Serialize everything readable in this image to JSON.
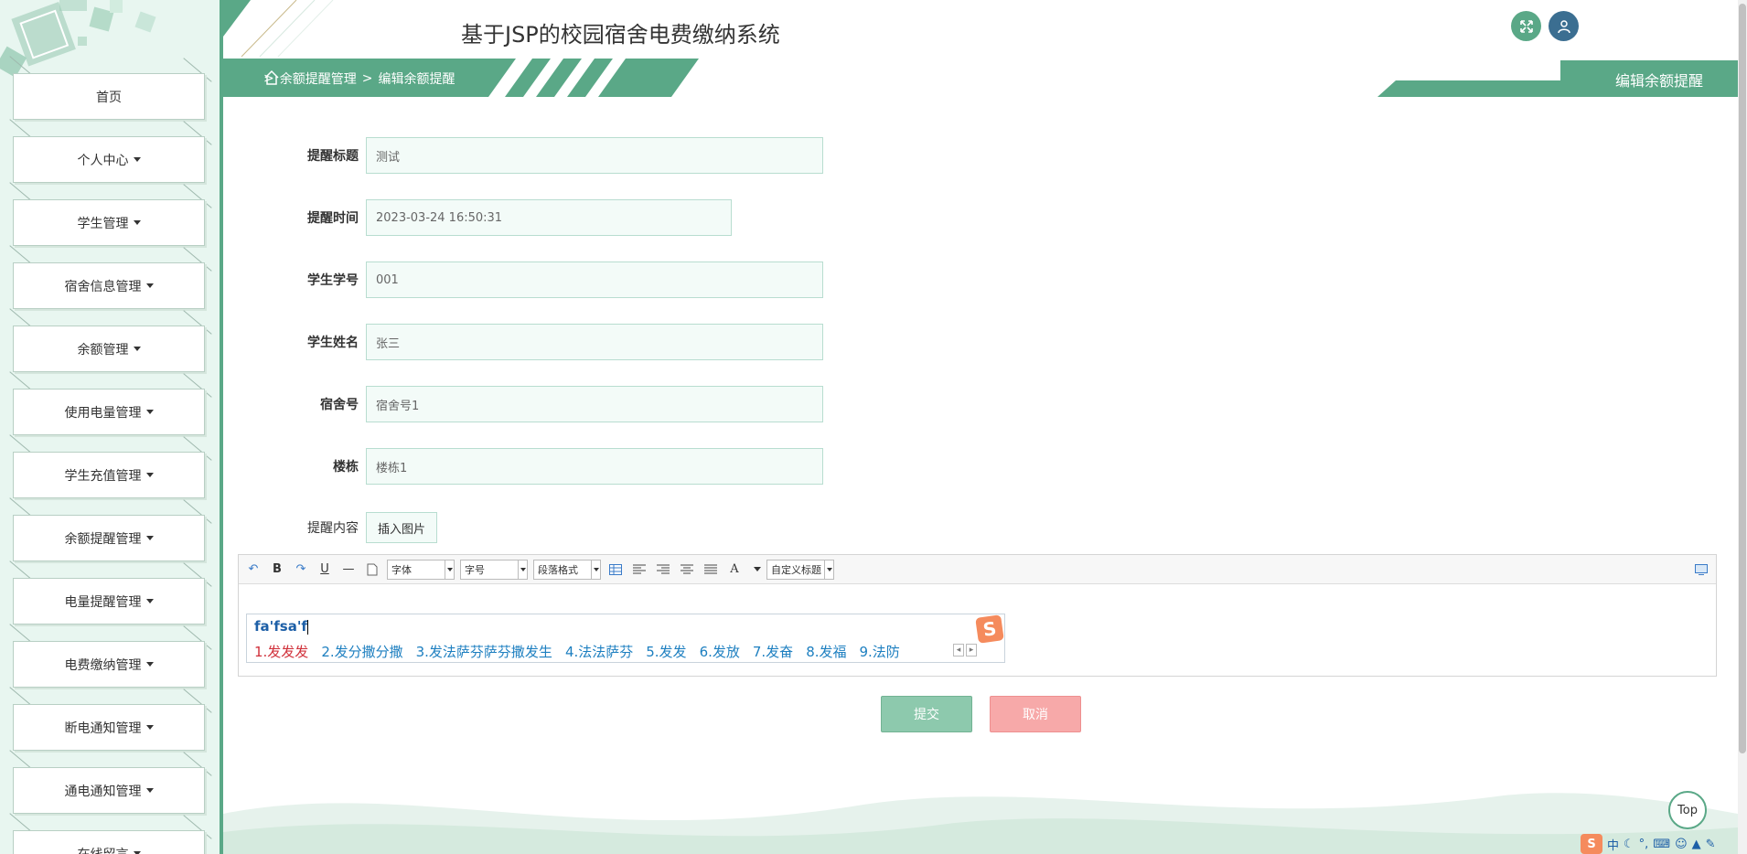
{
  "header": {
    "title": "基于JSP的校园宿舍电费缴纳系统"
  },
  "breadcrumb": {
    "sep1": ">",
    "item1": "余额提醒管理",
    "sep2": ">",
    "item2": "编辑余额提醒"
  },
  "page_tag": "编辑余额提醒",
  "sidebar": {
    "items": [
      {
        "label": "首页",
        "dropdown": false
      },
      {
        "label": "个人中心",
        "dropdown": true
      },
      {
        "label": "学生管理",
        "dropdown": true
      },
      {
        "label": "宿舍信息管理",
        "dropdown": true
      },
      {
        "label": "余额管理",
        "dropdown": true
      },
      {
        "label": "使用电量管理",
        "dropdown": true
      },
      {
        "label": "学生充值管理",
        "dropdown": true
      },
      {
        "label": "余额提醒管理",
        "dropdown": true
      },
      {
        "label": "电量提醒管理",
        "dropdown": true
      },
      {
        "label": "电费缴纳管理",
        "dropdown": true
      },
      {
        "label": "断电通知管理",
        "dropdown": true
      },
      {
        "label": "通电通知管理",
        "dropdown": true
      },
      {
        "label": "在线留言",
        "dropdown": true
      }
    ]
  },
  "form": {
    "title": {
      "label": "提醒标题",
      "value": "测试"
    },
    "time": {
      "label": "提醒时间",
      "value": "2023-03-24 16:50:31"
    },
    "student_no": {
      "label": "学生学号",
      "value": "001"
    },
    "student_name": {
      "label": "学生姓名",
      "value": "张三"
    },
    "dorm_no": {
      "label": "宿舍号",
      "value": "宿舍号1"
    },
    "building": {
      "label": "楼栋",
      "value": "楼栋1"
    },
    "content": {
      "label": "提醒内容",
      "insert_image": "插入图片"
    }
  },
  "editor": {
    "toolbar": {
      "undo": "↶",
      "bold": "B",
      "redo": "↷",
      "underline": "U",
      "hr": "—",
      "font": "字体",
      "size": "字号",
      "paragraph": "段落格式",
      "fontcolor": "A",
      "custom": "自定义标题"
    }
  },
  "ime": {
    "input": "fa'fsa'f",
    "candidates": [
      "1.发发发",
      "2.发分撒分撒",
      "3.发法萨芬萨芬撒发生",
      "4.法法萨芬",
      "5.发发",
      "6.发放",
      "7.发奋",
      "8.发福",
      "9.法防"
    ],
    "logo": "S"
  },
  "buttons": {
    "submit": "提交",
    "cancel": "取消",
    "top": "Top"
  },
  "taskbar": {
    "logo": "S",
    "lang": "中"
  },
  "colors": {
    "primary": "#5aa887",
    "sidebar_bg": "#e8f6f0",
    "user_btn": "#3b6e91",
    "submit": "#8dc9ad",
    "cancel": "#f7a9a9"
  }
}
